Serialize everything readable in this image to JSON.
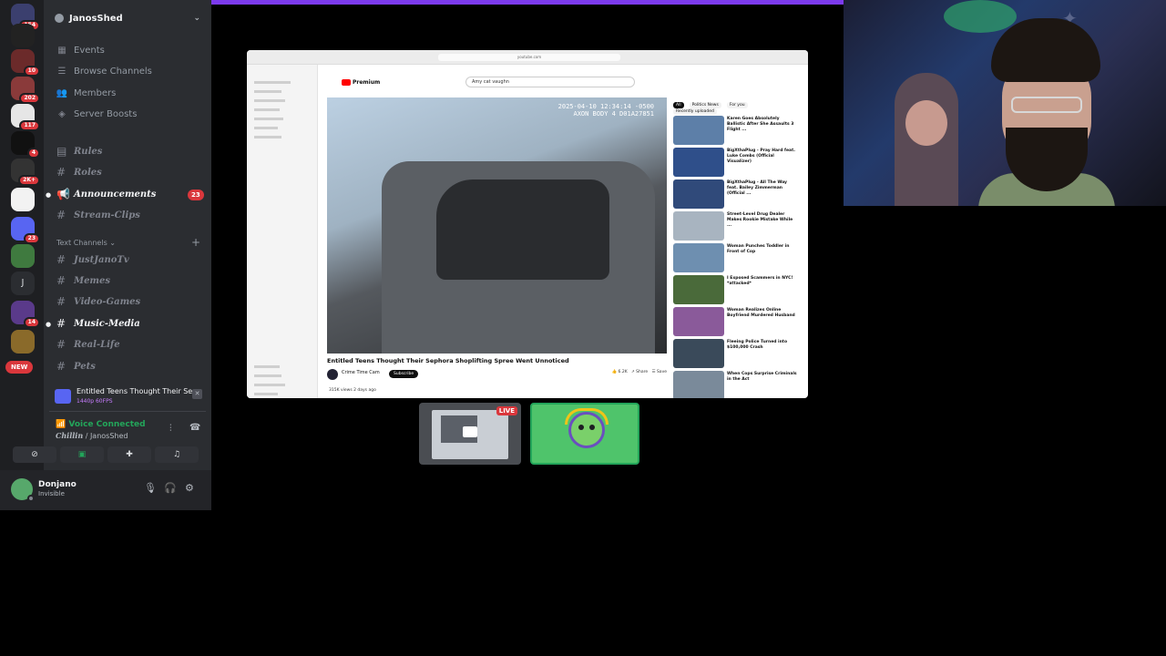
{
  "server_rail": {
    "badges": [
      "154",
      "10",
      "202",
      "117",
      "4",
      "2K+",
      "23",
      "14",
      "J"
    ],
    "new_pill": "NEW"
  },
  "sidebar": {
    "guild_name": "JanosShed",
    "nav": [
      {
        "label": "Events",
        "icon": "calendar-icon"
      },
      {
        "label": "Browse Channels",
        "icon": "browse-channels-icon"
      },
      {
        "label": "Members",
        "icon": "members-icon"
      },
      {
        "label": "Server Boosts",
        "icon": "boost-icon"
      }
    ],
    "channels_top": [
      {
        "label": "Rules"
      },
      {
        "label": "Roles"
      },
      {
        "label": "Announcements",
        "badge": "23"
      },
      {
        "label": "Stream-Clips"
      }
    ],
    "category": "Text Channels",
    "channels_text": [
      {
        "label": "JustJanoTv"
      },
      {
        "label": "Memes"
      },
      {
        "label": "Video-Games"
      },
      {
        "label": "Music-Media"
      },
      {
        "label": "Real-Life"
      },
      {
        "label": "Pets"
      }
    ]
  },
  "stream_notice": {
    "title": "Entitled Teens Thought Their Sephora Sh...",
    "sub": "1440p 60FPS"
  },
  "voice": {
    "status": "Voice Connected",
    "channel": "Chillin",
    "server": "JanosShed"
  },
  "user": {
    "name": "Donjano",
    "status": "Invisible"
  },
  "browser": {
    "url": "youtube.com",
    "yt_brand": "Premium",
    "search": "Amy cat vaughn",
    "timestamp_line1": "2025-04-10 12:34:14 -0500",
    "timestamp_line2": "AXON BODY 4 D01A27851",
    "video_title": "Entitled Teens Thought Their Sephora Shoplifting Spree Went Unnoticed",
    "channel_name": "Crime Time Cam",
    "subscribe": "Subscribe",
    "likes": "6.2K",
    "share": "Share",
    "save": "Save",
    "views_date": "315K views  2 days ago",
    "chips": [
      "All",
      "Politics News",
      "For you",
      "Recently uploaded"
    ],
    "recommendations": [
      "Karen Goes Absolutely Ballistic After She Assaults 3 Flight ...",
      "BigXthaPlug - Pray Hard feat. Luke Combs (Official Visualizer)",
      "BigXthaPlug - All The Way feat. Bailey Zimmerman (Official ...",
      "Street-Level Drug Dealer Makes Rookie Mistake While ...",
      "Woman Punches Toddler in Front of Cop",
      "I Exposed Scammers in NYC! *attacked*",
      "Woman Realizes Online Boyfriend Murdered Husband",
      "Fleeing Police Turned into $100,000 Crash",
      "When Cops Surprise Criminals in the Act"
    ]
  },
  "tiles": {
    "live": "LIVE"
  },
  "colors": {
    "discord_bg": "#2b2d31",
    "rail_bg": "#1e1f22",
    "accent_green": "#23a55a",
    "badge_red": "#da373c",
    "top_bar": "#7c3aed"
  }
}
